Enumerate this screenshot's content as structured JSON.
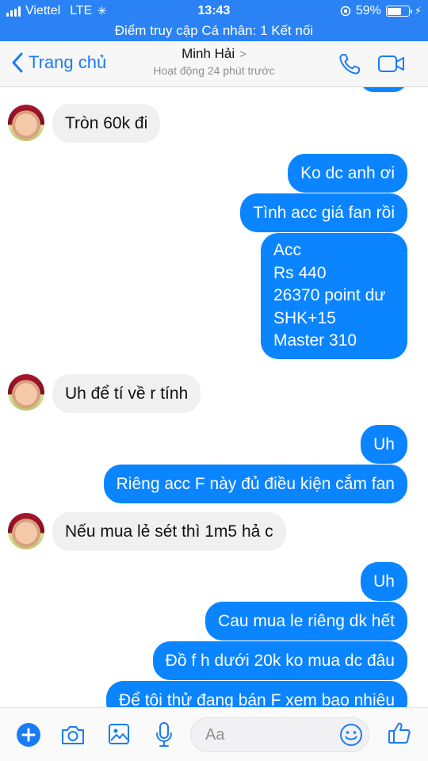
{
  "status_bar": {
    "carrier": "Viettel",
    "network": "LTE",
    "time": "13:43",
    "battery": "59%",
    "battery_level": 0.59
  },
  "hotspot": {
    "text": "Điểm truy cập Cá nhân: 1 Kết nối"
  },
  "header": {
    "back_label": "Trang chủ",
    "contact_name": "Minh Hải",
    "status": "Hoạt động 24 phút trước",
    "icons": [
      "back-chevron-icon",
      "phone-icon",
      "video-camera-icon"
    ]
  },
  "messages": [
    {
      "side": "in",
      "text": "Tròn 60k đi"
    },
    {
      "side": "out",
      "text": "Ko dc  anh ơi"
    },
    {
      "side": "out",
      "text": "Tình acc giá fan rồi"
    },
    {
      "side": "out",
      "lines": [
        "Acc",
        "Rs 440",
        "26370 point dư",
        "SHK+15",
        "Master 310"
      ]
    },
    {
      "side": "in",
      "text": "Uh để tí về r tính"
    },
    {
      "side": "out",
      "text": "Uh"
    },
    {
      "side": "out",
      "text": "Riêng acc F này đủ điều kiện cắm fan"
    },
    {
      "side": "in",
      "text": "Nếu mua lẻ sét thì 1m5 hả c"
    },
    {
      "side": "out",
      "text": "Uh"
    },
    {
      "side": "out",
      "text": "Cau mua le riêng dk hết"
    },
    {
      "side": "out",
      "text": "Đồ f h dưới 20k ko mua dc đâu"
    },
    {
      "side": "out",
      "text": "Để tôi thử đang bán F xem bao nhiêu"
    }
  ],
  "composer": {
    "placeholder": "Aa",
    "icons": [
      "plus-icon",
      "camera-icon",
      "image-icon",
      "microphone-icon",
      "emoji-icon",
      "like-icon"
    ]
  }
}
